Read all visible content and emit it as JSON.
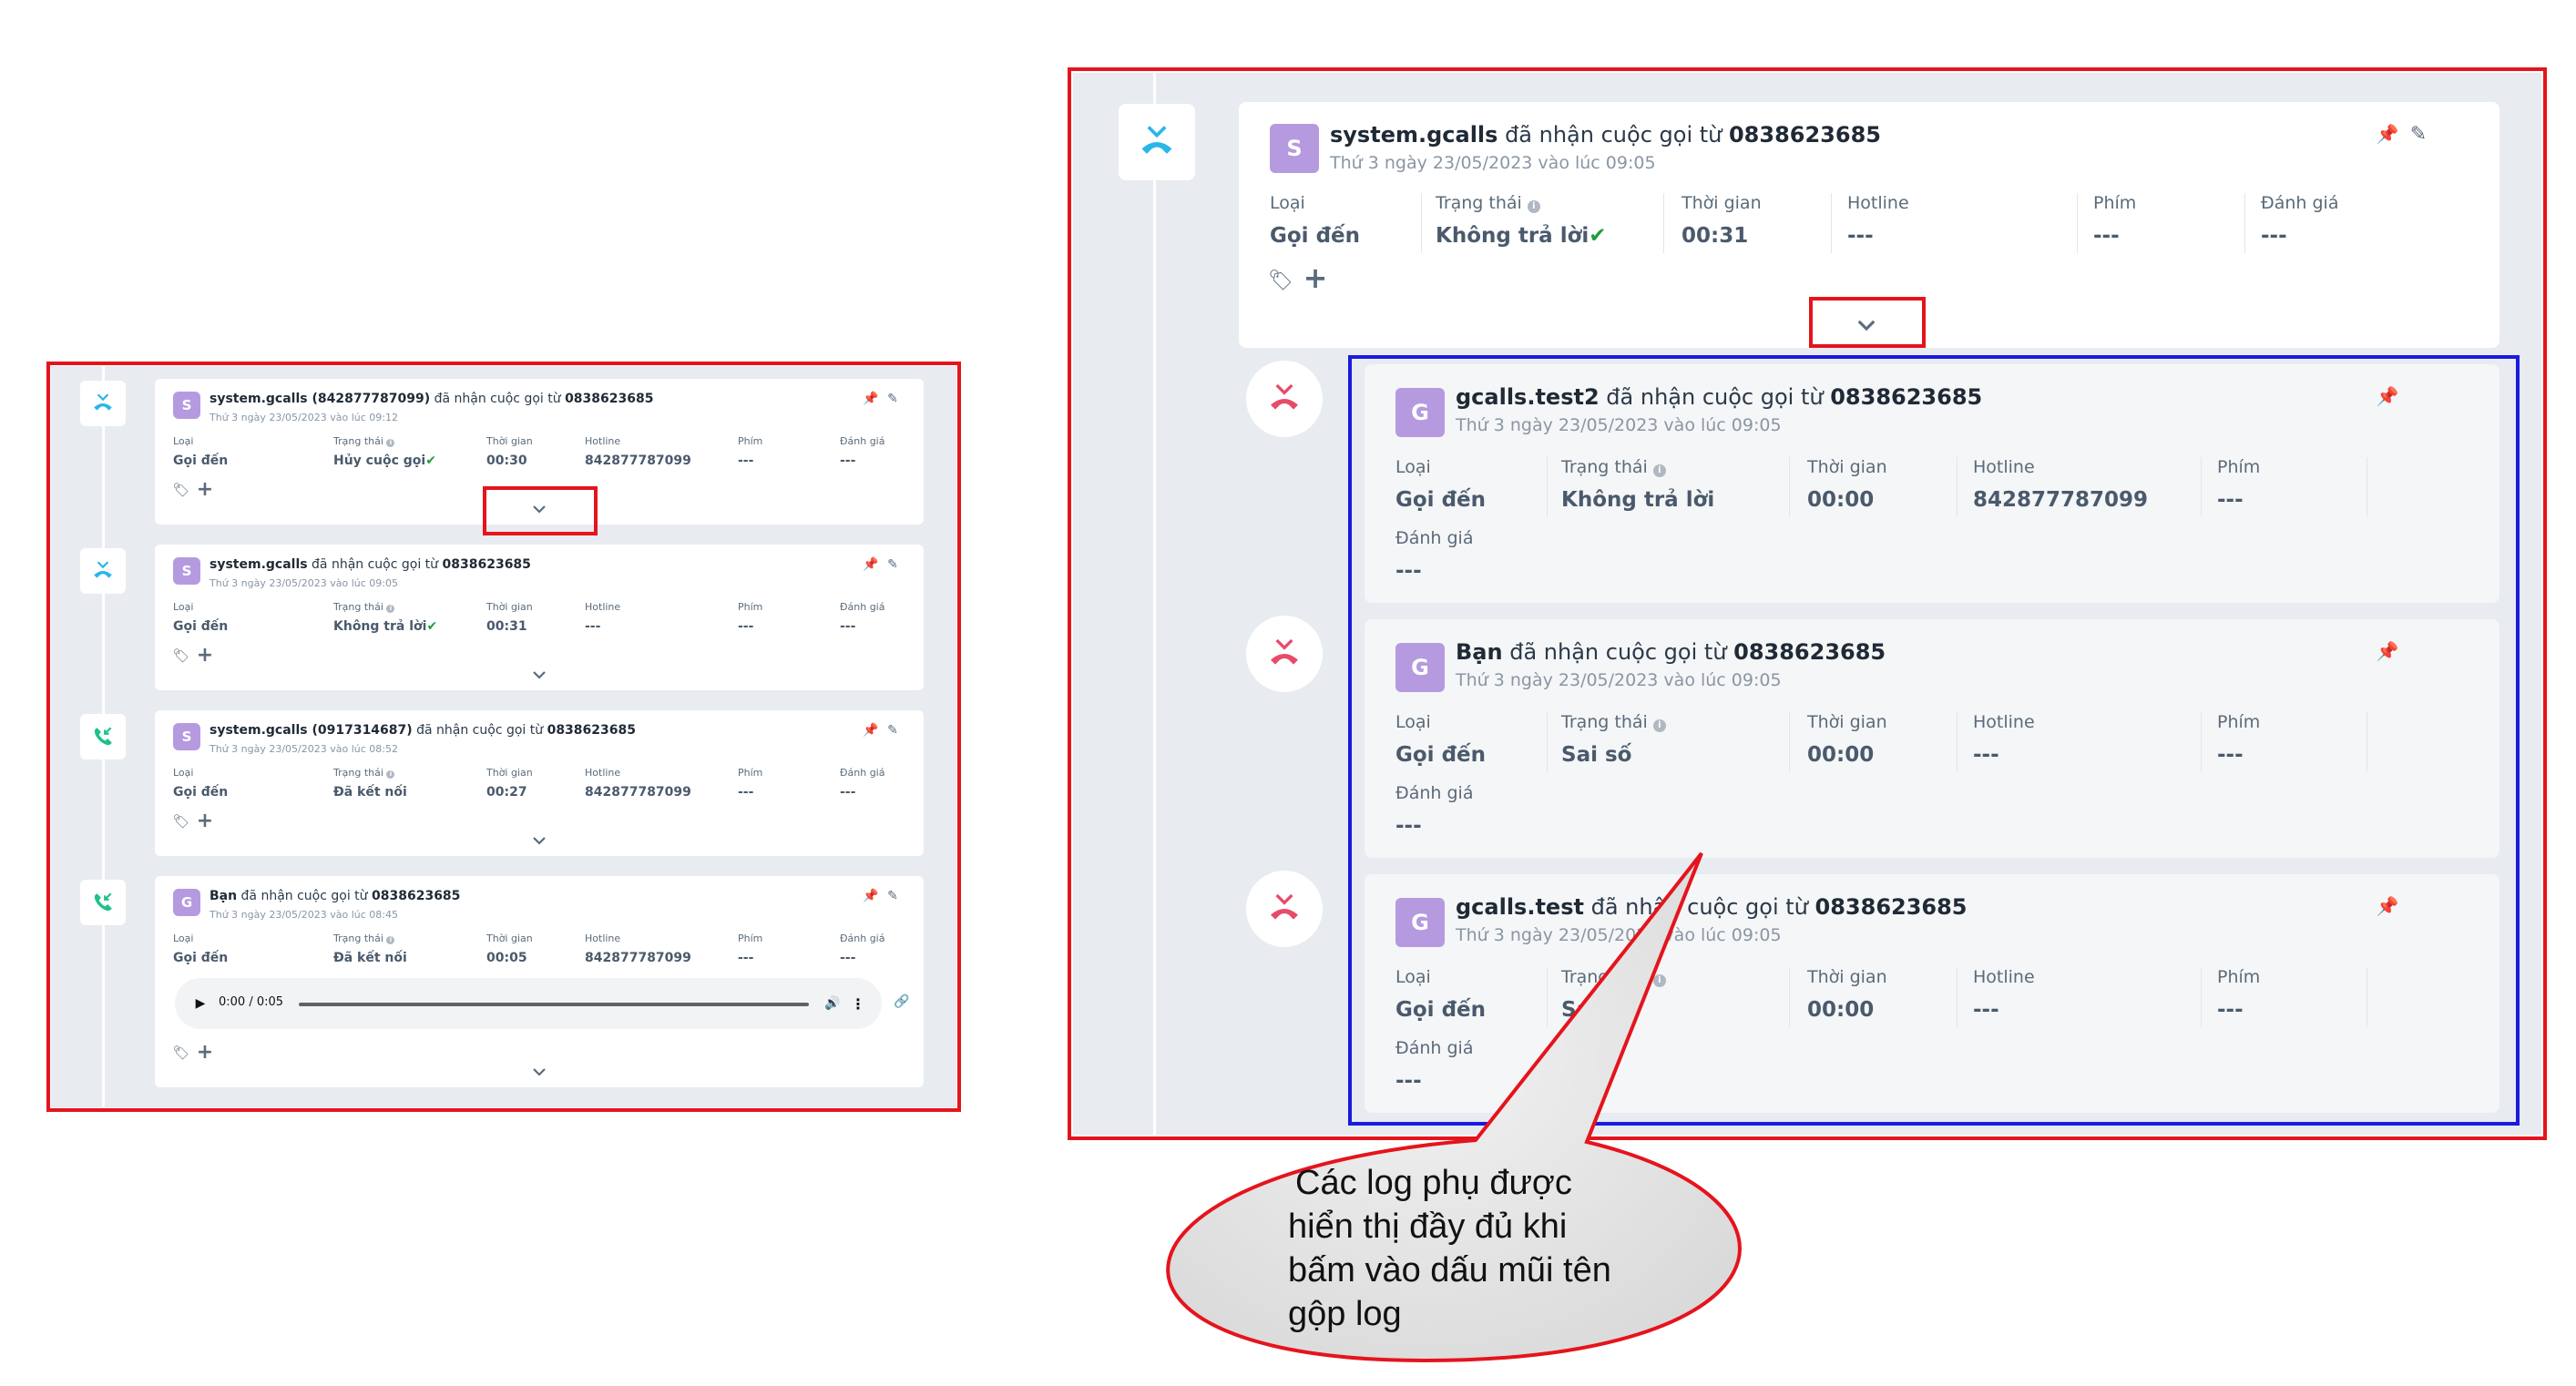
{
  "left": {
    "cards": [
      {
        "icon": "missed-call-icon",
        "avatar": "S",
        "title_bold": "system.gcalls (842877787099)",
        "title_rest": " đã nhận cuộc gọi từ ",
        "title_number": "0838623685",
        "date": "Thứ 3 ngày 23/05/2023 vào lúc 09:12",
        "fields": [
          {
            "label": "Loại",
            "value": "Gọi đến"
          },
          {
            "label": "Trạng thái",
            "value": "Hủy cuộc gọi"
          },
          {
            "label": "Thời gian",
            "value": "00:30"
          },
          {
            "label": "Hotline",
            "value": "842877787099"
          },
          {
            "label": "Phím",
            "value": "---"
          },
          {
            "label": "Đánh giá",
            "value": "---"
          }
        ]
      },
      {
        "icon": "missed-call-icon",
        "avatar": "S",
        "title_bold": "system.gcalls",
        "title_rest": " đã nhận cuộc gọi từ ",
        "title_number": "0838623685",
        "date": "Thứ 3 ngày 23/05/2023 vào lúc 09:05",
        "fields": [
          {
            "label": "Loại",
            "value": "Gọi đến"
          },
          {
            "label": "Trạng thái",
            "value": "Không trả lời"
          },
          {
            "label": "Thời gian",
            "value": "00:31"
          },
          {
            "label": "Hotline",
            "value": "---"
          },
          {
            "label": "Phím",
            "value": "---"
          },
          {
            "label": "Đánh giá",
            "value": "---"
          }
        ]
      },
      {
        "icon": "incoming-call-icon",
        "avatar": "S",
        "title_bold": "system.gcalls (0917314687)",
        "title_rest": " đã nhận cuộc gọi từ ",
        "title_number": "0838623685",
        "date": "Thứ 3 ngày 23/05/2023 vào lúc 08:52",
        "fields": [
          {
            "label": "Loại",
            "value": "Gọi đến"
          },
          {
            "label": "Trạng thái",
            "value": "Đã kết nối"
          },
          {
            "label": "Thời gian",
            "value": "00:27"
          },
          {
            "label": "Hotline",
            "value": "842877787099"
          },
          {
            "label": "Phím",
            "value": "---"
          },
          {
            "label": "Đánh giá",
            "value": "---"
          }
        ]
      },
      {
        "icon": "incoming-call-icon",
        "avatar": "G",
        "title_bold": "Bạn",
        "title_rest": " đã nhận cuộc gọi từ ",
        "title_number": "0838623685",
        "date": "Thứ 3 ngày 23/05/2023 vào lúc 08:45",
        "fields": [
          {
            "label": "Loại",
            "value": "Gọi đến"
          },
          {
            "label": "Trạng thái",
            "value": "Đã kết nối"
          },
          {
            "label": "Thời gian",
            "value": "00:05"
          },
          {
            "label": "Hotline",
            "value": "842877787099"
          },
          {
            "label": "Phím",
            "value": "---"
          },
          {
            "label": "Đánh giá",
            "value": "---"
          }
        ],
        "audio_time": "0:00 / 0:05"
      }
    ]
  },
  "right": {
    "main": {
      "avatar": "S",
      "title_bold": "system.gcalls",
      "title_rest": " đã nhận cuộc gọi từ ",
      "title_number": "0838623685",
      "date": "Thứ 3 ngày 23/05/2023 vào lúc 09:05",
      "fields": [
        {
          "label": "Loại",
          "value": "Gọi đến"
        },
        {
          "label": "Trạng thái",
          "value": "Không trả lời"
        },
        {
          "label": "Thời gian",
          "value": "00:31"
        },
        {
          "label": "Hotline",
          "value": "---"
        },
        {
          "label": "Phím",
          "value": "---"
        },
        {
          "label": "Đánh giá",
          "value": "---"
        }
      ]
    },
    "sub": [
      {
        "avatar": "G",
        "title_bold": "gcalls.test2",
        "title_rest": " đã nhận cuộc gọi từ ",
        "title_number": "0838623685",
        "date": "Thứ 3 ngày 23/05/2023 vào lúc 09:05",
        "fields": [
          {
            "label": "Loại",
            "value": "Gọi đến"
          },
          {
            "label": "Trạng thái",
            "value": "Không trả lời"
          },
          {
            "label": "Thời gian",
            "value": "00:00"
          },
          {
            "label": "Hotline",
            "value": "842877787099"
          },
          {
            "label": "Phím",
            "value": "---"
          }
        ],
        "rating": {
          "label": "Đánh giá",
          "value": "---"
        }
      },
      {
        "avatar": "G",
        "title_bold": "Bạn",
        "title_rest": " đã nhận cuộc gọi từ ",
        "title_number": "0838623685",
        "date": "Thứ 3 ngày 23/05/2023 vào lúc 09:05",
        "fields": [
          {
            "label": "Loại",
            "value": "Gọi đến"
          },
          {
            "label": "Trạng thái",
            "value": "Sai số"
          },
          {
            "label": "Thời gian",
            "value": "00:00"
          },
          {
            "label": "Hotline",
            "value": "---"
          },
          {
            "label": "Phím",
            "value": "---"
          }
        ],
        "rating": {
          "label": "Đánh giá",
          "value": "---"
        }
      },
      {
        "avatar": "G",
        "title_bold": "gcalls.test",
        "title_rest": " đã nhận cuộc gọi từ ",
        "title_number": "0838623685",
        "date": "Thứ 3 ngày 23/05/2023 vào lúc 09:05",
        "fields": [
          {
            "label": "Loại",
            "value": "Gọi đến"
          },
          {
            "label": "Trạng thái",
            "value": "Sai số"
          },
          {
            "label": "Thời gian",
            "value": "00:00"
          },
          {
            "label": "Hotline",
            "value": "---"
          },
          {
            "label": "Phím",
            "value": "---"
          }
        ],
        "rating": {
          "label": "Đánh giá",
          "value": "---"
        }
      }
    ]
  },
  "callout": {
    "lines": [
      "Các log phụ được",
      "hiển thị đầy đủ khi",
      "bấm vào dấu mũi tên",
      "gộp log"
    ]
  },
  "colors": {
    "annotation_red": "#e5141c",
    "annotation_blue": "#1a1ae0",
    "missed_icon": "#29b6e8",
    "incoming_icon": "#1ec28b",
    "sub_icon": "#e84a6a",
    "avatar": "#b59ae0"
  }
}
